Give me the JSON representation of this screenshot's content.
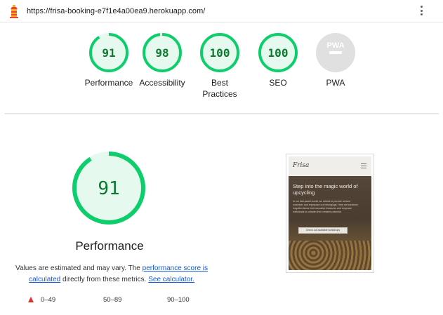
{
  "header": {
    "url": "https://frisa-booking-e7f1e4a00ea9.herokuapp.com/",
    "logo_icon": "lighthouse-icon",
    "menu_icon": "more-vert-icon"
  },
  "colors": {
    "pass_green": "#0cce6b",
    "pass_fill": "#e6f9ee",
    "pass_text": "#0b7a30",
    "na_grey": "#e0e0e0",
    "fail_red": "#e0312a",
    "link_blue": "#1558d6"
  },
  "categories": [
    {
      "label": "Performance",
      "score": "91"
    },
    {
      "label": "Accessibility",
      "score": "98"
    },
    {
      "label": "Best Practices",
      "label_lines": [
        "Best",
        "Practices"
      ],
      "score": "100"
    },
    {
      "label": "SEO",
      "score": "100"
    },
    {
      "label": "PWA",
      "score": "PWA"
    }
  ],
  "main": {
    "score": "91",
    "score_value": 91,
    "title": "Performance",
    "note_before": "Values are estimated and may vary. The ",
    "note_link1": "performance score is calculated",
    "note_middle": " directly from these metrics. ",
    "note_link2": "See calculator."
  },
  "legend": [
    {
      "range": "0–49",
      "icon": "fail-triangle-icon"
    },
    {
      "range": "50–89",
      "icon": "average-square-icon"
    },
    {
      "range": "90–100",
      "icon": "pass-circle-icon"
    }
  ],
  "thumbnail": {
    "brand": "Frisa",
    "heading": "Step into the magic world of upcycling",
    "body": "In our fast-paced world, we strived to provide venture ourselves and repurpose our belongings. Here we transform forgotten items into innovative treasures and empower individuals to unleash their creative potential.",
    "button": "Check out available workshops"
  }
}
